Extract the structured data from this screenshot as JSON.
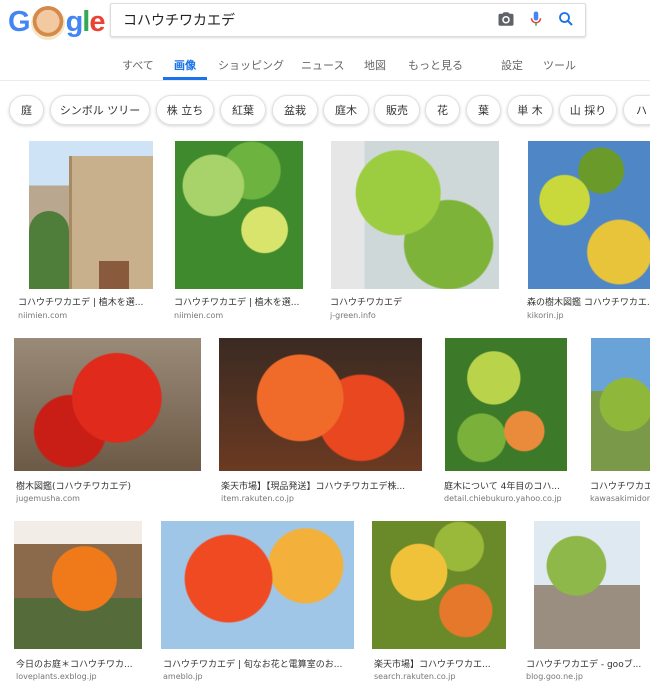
{
  "search": {
    "query": "コハウチワカエデ"
  },
  "tabs": [
    {
      "label": "すべて"
    },
    {
      "label": "画像"
    },
    {
      "label": "ショッピング"
    },
    {
      "label": "ニュース"
    },
    {
      "label": "地図"
    },
    {
      "label": "もっと見る"
    },
    {
      "label": "設定"
    },
    {
      "label": "ツール"
    }
  ],
  "chips": [
    "庭",
    "シンボル ツリー",
    "株 立ち",
    "紅葉",
    "盆栽",
    "庭木",
    "販売",
    "花",
    "葉",
    "単 木",
    "山 採り",
    "ハ"
  ],
  "results": [
    {
      "caption": "コハウチワカエデ | 植木を選...",
      "domain": "niimien.com"
    },
    {
      "caption": "コハウチワカエデ | 植木を選...",
      "domain": "niimien.com"
    },
    {
      "caption": "コハウチワカエデ",
      "domain": "j-green.info"
    },
    {
      "caption": "森の樹木図鑑 コハウチワカエ...",
      "domain": "kikorin.jp"
    },
    {
      "caption": "樹木図鑑(コハウチワカエデ)",
      "domain": "jugemusha.com"
    },
    {
      "caption": "楽天市場】【現品発送】コハウチワカエデ株...",
      "domain": "item.rakuten.co.jp"
    },
    {
      "caption": "庭木について 4年目のコハ...",
      "domain": "detail.chiebukuro.yahoo.co.jp"
    },
    {
      "caption": "コハウチワカエ",
      "domain": "kawasakimidori..."
    },
    {
      "caption": "今日のお庭＊コハウチワカ...",
      "domain": "loveplants.exblog.jp"
    },
    {
      "caption": "コハウチワカエデ | 旬なお花と電算室のお...",
      "domain": "ameblo.jp"
    },
    {
      "caption": "楽天市場】コハウチワカエ...",
      "domain": "search.rakuten.co.jp"
    },
    {
      "caption": "コハウチワカエデ - gooブ...",
      "domain": "blog.goo.ne.jp"
    }
  ],
  "colors": {
    "accent": "#1a73e8"
  }
}
